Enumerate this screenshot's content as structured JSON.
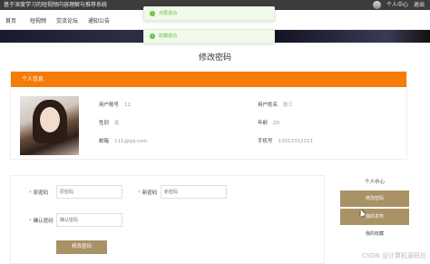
{
  "topbar": {
    "site_title": "基于深度学习的短视频内容理解与推荐系统",
    "user_center": "个人中心",
    "logout": "退出"
  },
  "nav": [
    {
      "label": "首页"
    },
    {
      "label": "短视频"
    },
    {
      "label": "交流论坛"
    },
    {
      "label": "通知公告"
    }
  ],
  "toasts": [
    "点赞成功",
    "收藏成功"
  ],
  "page_title": "修改密码",
  "info": {
    "header": "个人信息",
    "account_label": "用户账号",
    "account_value": "11",
    "name_label": "用户姓名",
    "name_value": "张三",
    "gender_label": "性别",
    "gender_value": "女",
    "age_label": "年龄",
    "age_value": "20",
    "email_label": "邮箱",
    "email_value": "111@qq.com",
    "phone_label": "手机号",
    "phone_value": "13012312311"
  },
  "form": {
    "old_label": "原密码",
    "old_placeholder": "原密码",
    "new_label": "新密码",
    "new_placeholder": "新密码",
    "confirm_label": "确认密码",
    "confirm_placeholder": "确认密码",
    "submit": "修改密码"
  },
  "sidebar": {
    "title": "个人中心",
    "items": [
      {
        "label": "修改密码"
      },
      {
        "label": "我的发布"
      },
      {
        "label": "我的收藏"
      }
    ]
  },
  "watermark": "CSDN @计算机源码社",
  "colors": {
    "accent": "#f57c08",
    "button": "#a89266",
    "success": "#67c23a"
  }
}
